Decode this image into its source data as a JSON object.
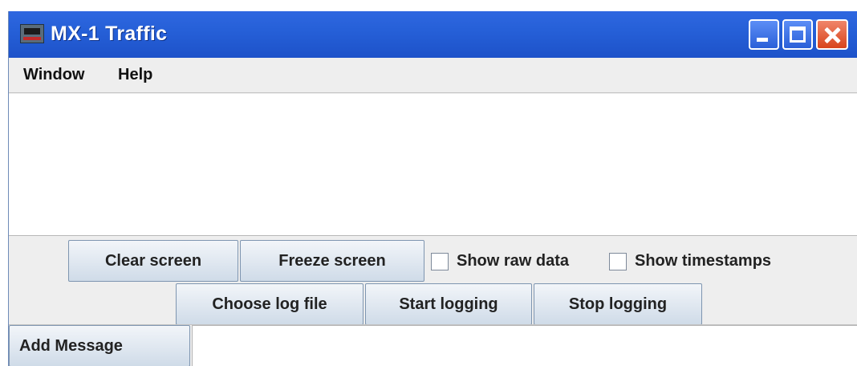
{
  "window": {
    "title": "MX-1 Traffic",
    "icon": "train-icon"
  },
  "title_buttons": {
    "minimize_icon": "minimize-icon",
    "maximize_icon": "maximize-icon",
    "close_icon": "close-icon"
  },
  "menu": {
    "items": [
      {
        "label": "Window"
      },
      {
        "label": "Help"
      }
    ]
  },
  "traffic": {
    "content": ""
  },
  "controls": {
    "clear_label": "Clear screen",
    "freeze_label": "Freeze screen",
    "show_raw_label": "Show raw data",
    "show_raw_checked": false,
    "show_timestamps_label": "Show timestamps",
    "show_timestamps_checked": false,
    "choose_log_label": "Choose log file",
    "start_logging_label": "Start logging",
    "stop_logging_label": "Stop logging"
  },
  "message": {
    "add_label": "Add Message",
    "value": ""
  },
  "colors": {
    "titlebar": "#2660d8",
    "close_button": "#d8441c",
    "button_face": "#dfe7f0"
  }
}
